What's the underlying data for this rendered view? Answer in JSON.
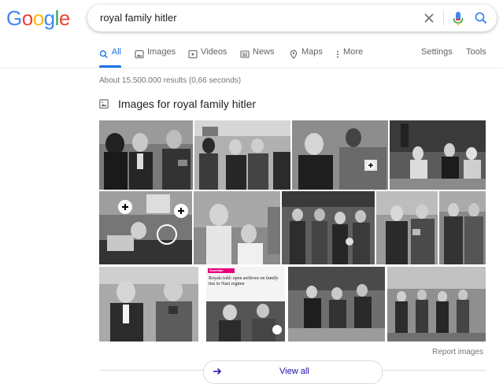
{
  "logo": {
    "letters": [
      "G",
      "o",
      "o",
      "g",
      "l",
      "e"
    ],
    "colors": [
      "#4285f4",
      "#ea4335",
      "#fbbc05",
      "#4285f4",
      "#34a853",
      "#ea4335"
    ]
  },
  "search": {
    "query": "royal family hitler"
  },
  "tabs": [
    {
      "label": "All",
      "icon": "search-icon",
      "active": true
    },
    {
      "label": "Images",
      "icon": "image-icon"
    },
    {
      "label": "Videos",
      "icon": "play-icon"
    },
    {
      "label": "News",
      "icon": "news-icon"
    },
    {
      "label": "Maps",
      "icon": "map-pin-icon"
    },
    {
      "label": "More",
      "icon": "more-vert-icon"
    }
  ],
  "tools": {
    "settings": "Settings",
    "tools": "Tools"
  },
  "result_stats": "About 15.500.000 results (0,66 seconds)",
  "images_section": {
    "title": "Images for royal family hitler",
    "tile3_headline": "Royals told: open archives on family ties to Nazi regime",
    "tile3_tag": "Guardian",
    "report": "Report images",
    "view_all": "View all"
  },
  "colors": {
    "accent": "#1a73e8",
    "link": "#1a0dab",
    "text_muted": "#70757a"
  }
}
